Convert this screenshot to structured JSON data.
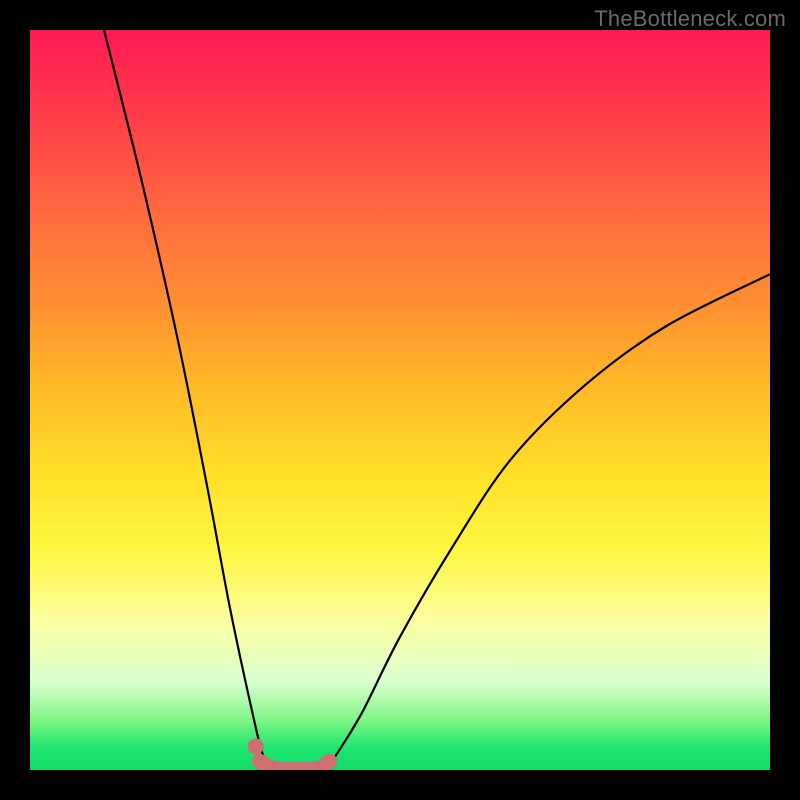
{
  "watermark": "TheBottleneck.com",
  "chart_data": {
    "type": "line",
    "title": "",
    "xlabel": "",
    "ylabel": "",
    "xlim": [
      0,
      100
    ],
    "ylim": [
      0,
      100
    ],
    "gradient_description": "vertical gradient: red at top through orange, yellow, pale yellow, to green at bottom",
    "series": [
      {
        "name": "left-branch",
        "color": "#000000",
        "x": [
          10,
          15,
          20,
          24,
          27,
          30,
          31.5,
          33
        ],
        "y": [
          100,
          80,
          58,
          38,
          22,
          8,
          2,
          0
        ]
      },
      {
        "name": "right-branch",
        "color": "#000000",
        "x": [
          40,
          42,
          45,
          50,
          57,
          65,
          75,
          86,
          100
        ],
        "y": [
          0,
          3,
          8,
          18,
          30,
          42,
          52,
          60,
          67
        ]
      },
      {
        "name": "flat-bottom-marker",
        "color": "#d46a6a",
        "x": [
          31,
          33,
          36,
          39,
          40.5
        ],
        "y": [
          1.2,
          0.2,
          0.1,
          0.2,
          1.2
        ]
      },
      {
        "name": "dot-marker",
        "color": "#d46a6a",
        "x": [
          30.5
        ],
        "y": [
          3.2
        ]
      }
    ]
  }
}
